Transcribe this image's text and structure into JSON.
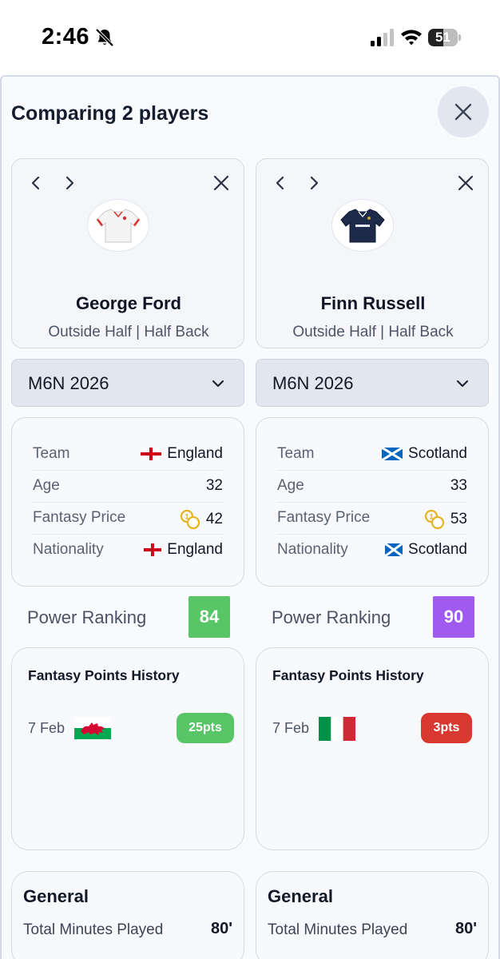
{
  "status_bar": {
    "time": "2:46",
    "battery": "51",
    "battery_level": 0.51
  },
  "header": {
    "title": "Comparing 2 players"
  },
  "players": [
    {
      "name": "George Ford",
      "position": "Outside Half | Half Back",
      "jersey": "england-jersey-icon",
      "season": "M6N 2026",
      "info": {
        "team_label": "Team",
        "team": "England",
        "team_flag": "england-flag-icon",
        "age_label": "Age",
        "age": "32",
        "price_label": "Fantasy Price",
        "price": "42",
        "nationality_label": "Nationality",
        "nationality": "England",
        "nationality_flag": "england-flag-icon"
      },
      "power_label": "Power Ranking",
      "power": "84",
      "power_color": "#58c566",
      "history_title": "Fantasy Points History",
      "history": [
        {
          "date": "7 Feb",
          "opponent_flag": "wales-flag-icon",
          "points": "25pts",
          "color": "#58c566"
        }
      ],
      "general_title": "General",
      "minutes_label": "Total Minutes Played",
      "minutes": "80'"
    },
    {
      "name": "Finn Russell",
      "position": "Outside Half | Half Back",
      "jersey": "scotland-jersey-icon",
      "season": "M6N 2026",
      "info": {
        "team_label": "Team",
        "team": "Scotland",
        "team_flag": "scotland-flag-icon",
        "age_label": "Age",
        "age": "33",
        "price_label": "Fantasy Price",
        "price": "53",
        "nationality_label": "Nationality",
        "nationality": "Scotland",
        "nationality_flag": "scotland-flag-icon"
      },
      "power_label": "Power Ranking",
      "power": "90",
      "power_color": "#a05af0",
      "history_title": "Fantasy Points History",
      "history": [
        {
          "date": "7 Feb",
          "opponent_flag": "italy-flag-icon",
          "points": "3pts",
          "color": "#d93830"
        }
      ],
      "general_title": "General",
      "minutes_label": "Total Minutes Played",
      "minutes": "80'"
    }
  ]
}
